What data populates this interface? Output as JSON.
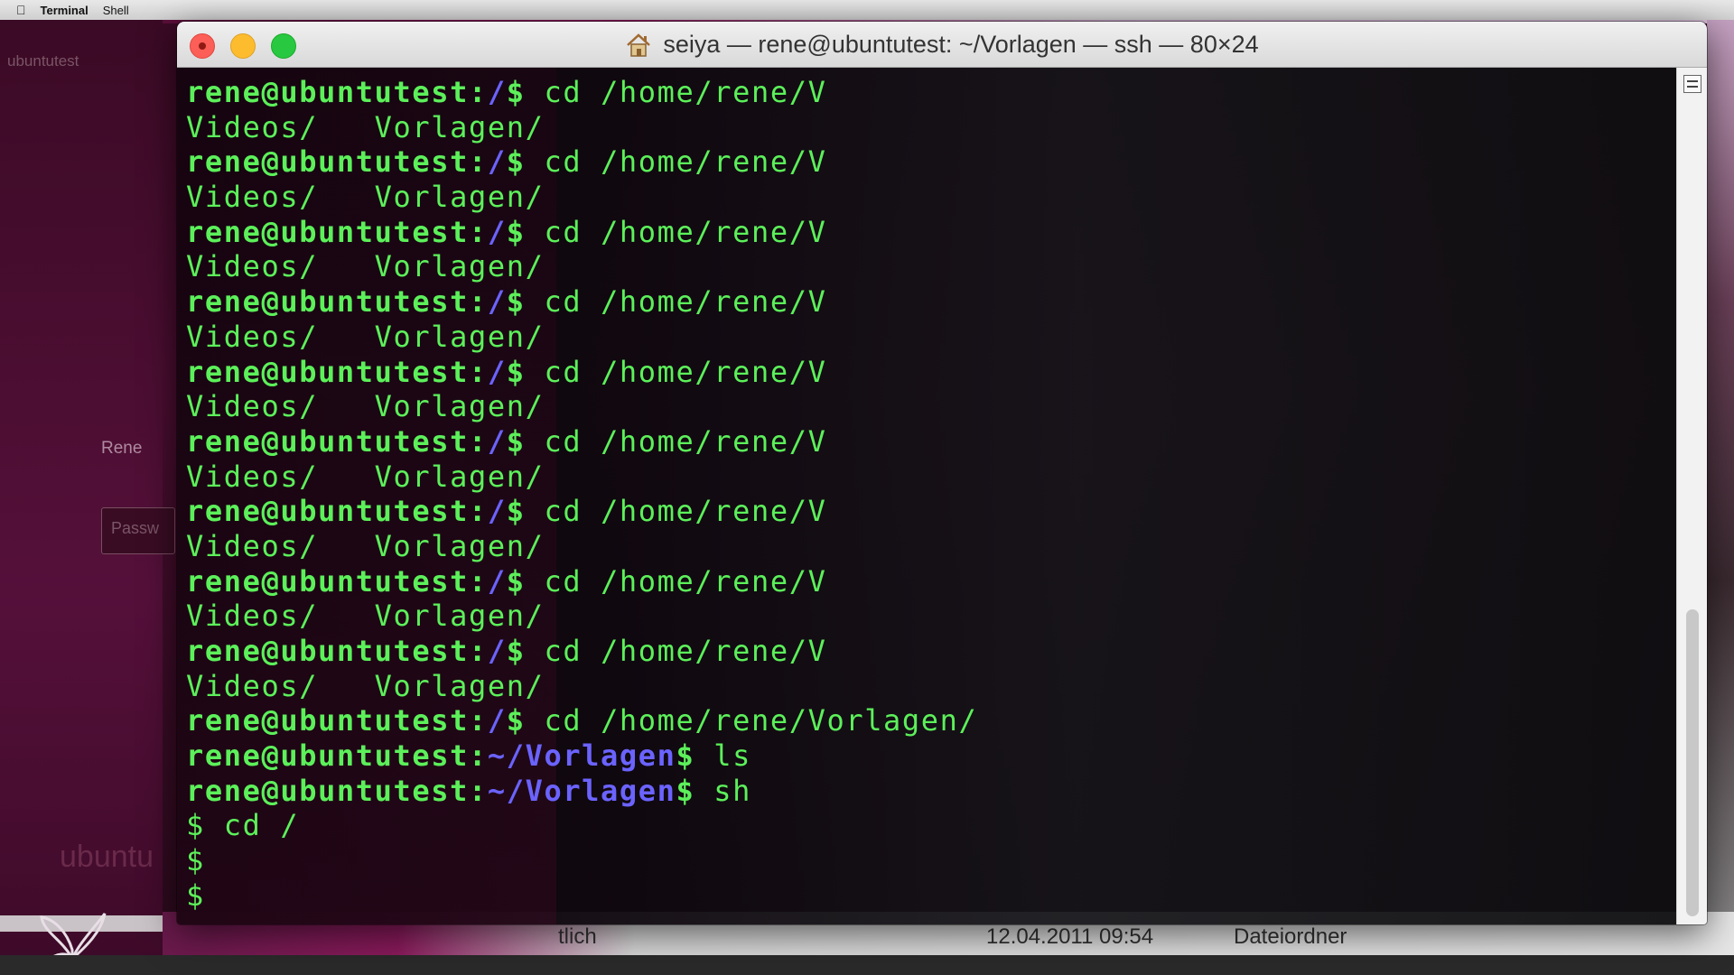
{
  "menubar": {
    "apple_icon": "apple-icon",
    "items": [
      "Terminal",
      "Shell"
    ]
  },
  "background_app": {
    "hostname": "ubuntutest",
    "user_label": "Rene",
    "password_placeholder": "Passw",
    "watermark": "ubuntu"
  },
  "finder": {
    "col_kind_partial": "tlich",
    "date": "12.04.2011 09:54",
    "kind": "Dateiordner"
  },
  "window": {
    "title": "seiya — rene@ubuntutest: ~/Vorlagen — ssh — 80×24",
    "title_icon": "home-icon"
  },
  "terminal": {
    "prompt_user": "rene@ubuntutest:",
    "lines": [
      {
        "type": "prompt",
        "path": "/",
        "cmd": " cd /home/rene/V"
      },
      {
        "type": "output",
        "text": "Videos/   Vorlagen/"
      },
      {
        "type": "prompt",
        "path": "/",
        "cmd": " cd /home/rene/V"
      },
      {
        "type": "output",
        "text": "Videos/   Vorlagen/"
      },
      {
        "type": "prompt",
        "path": "/",
        "cmd": " cd /home/rene/V"
      },
      {
        "type": "output",
        "text": "Videos/   Vorlagen/"
      },
      {
        "type": "prompt",
        "path": "/",
        "cmd": " cd /home/rene/V"
      },
      {
        "type": "output",
        "text": "Videos/   Vorlagen/"
      },
      {
        "type": "prompt",
        "path": "/",
        "cmd": " cd /home/rene/V"
      },
      {
        "type": "output",
        "text": "Videos/   Vorlagen/"
      },
      {
        "type": "prompt",
        "path": "/",
        "cmd": " cd /home/rene/V"
      },
      {
        "type": "output",
        "text": "Videos/   Vorlagen/"
      },
      {
        "type": "prompt",
        "path": "/",
        "cmd": " cd /home/rene/V"
      },
      {
        "type": "output",
        "text": "Videos/   Vorlagen/"
      },
      {
        "type": "prompt",
        "path": "/",
        "cmd": " cd /home/rene/V"
      },
      {
        "type": "output",
        "text": "Videos/   Vorlagen/"
      },
      {
        "type": "prompt",
        "path": "/",
        "cmd": " cd /home/rene/V"
      },
      {
        "type": "output",
        "text": "Videos/   Vorlagen/"
      },
      {
        "type": "prompt",
        "path": "/",
        "cmd": " cd /home/rene/Vorlagen/"
      },
      {
        "type": "prompt",
        "path": "~/Vorlagen",
        "cmd": " ls"
      },
      {
        "type": "prompt",
        "path": "~/Vorlagen",
        "cmd": " sh"
      },
      {
        "type": "output",
        "text": "$ cd /"
      },
      {
        "type": "output",
        "text": "$"
      },
      {
        "type": "output",
        "text": "$"
      }
    ]
  },
  "colors": {
    "terminal_green": "#5cf05a",
    "prompt_path_blue": "#6b63ff",
    "close": "#fc5f57",
    "minimize": "#fdbc2e",
    "maximize": "#28c840"
  }
}
